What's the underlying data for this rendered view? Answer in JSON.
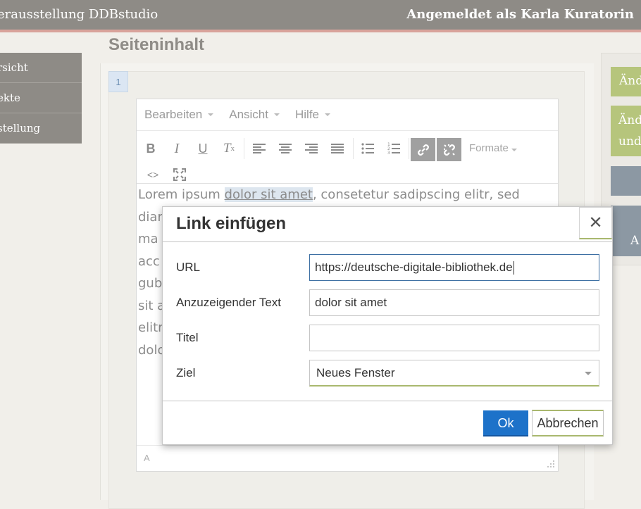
{
  "header": {
    "brand": "erausstellung DDBstudio",
    "user": "Angemeldet als Karla Kuratorin"
  },
  "sidebar": {
    "items": [
      {
        "label": "rsicht"
      },
      {
        "label": "ekte"
      },
      {
        "label": "stellung"
      }
    ]
  },
  "main": {
    "title": "Seiteninhalt",
    "section_number": "1"
  },
  "editor": {
    "menus": [
      {
        "label": "Bearbeiten"
      },
      {
        "label": "Ansicht"
      },
      {
        "label": "Hilfe"
      }
    ],
    "toolbar": {
      "formats_label": "Formate",
      "buttons": [
        "bold-icon",
        "italic-icon",
        "underline-icon",
        "clear-format-icon",
        "align-left-icon",
        "align-center-icon",
        "align-right-icon",
        "align-justify-icon",
        "bullet-list-icon",
        "numbered-list-icon",
        "link-icon",
        "unlink-icon",
        "source-code-icon",
        "fullscreen-icon"
      ]
    },
    "content": {
      "line1_before": "Lorem ipsum ",
      "line1_link": "dolor sit amet",
      "line1_after": ", consetetur sadipscing elitr, sed",
      "fragments": [
        "diar",
        "ma",
        "acc",
        "gub",
        "sit a",
        "elitr",
        "dolo"
      ]
    },
    "status_path": "A"
  },
  "right_panel": {
    "buttons": [
      {
        "label": "Änd",
        "color": "#b6c57c"
      },
      {
        "label_line1": "Änd",
        "label_line2": "und",
        "color": "#b6c57c"
      },
      {
        "label": "",
        "color": "#8c98a3"
      },
      {
        "label": "A",
        "color": "#8c98a3"
      }
    ]
  },
  "dialog": {
    "title": "Link einfügen",
    "close_icon": "close-icon",
    "fields": {
      "url": {
        "label": "URL",
        "value": "https://deutsche-digitale-bibliothek.de"
      },
      "text": {
        "label": "Anzuzeigender Text",
        "value": "dolor sit amet"
      },
      "title": {
        "label": "Titel",
        "value": ""
      },
      "target": {
        "label": "Ziel",
        "value": "Neues Fenster"
      }
    },
    "ok_label": "Ok",
    "cancel_label": "Abbrechen",
    "accent_color": "#1d72c9"
  }
}
